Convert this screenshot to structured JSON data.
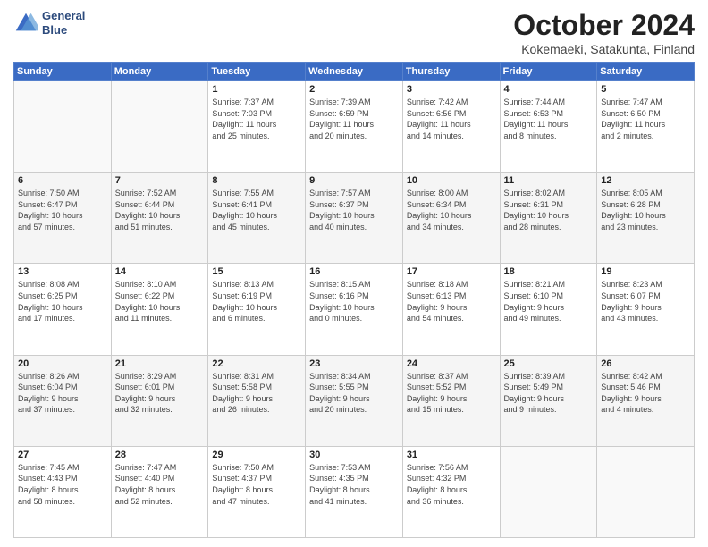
{
  "header": {
    "logo_line1": "General",
    "logo_line2": "Blue",
    "month": "October 2024",
    "location": "Kokemaeki, Satakunta, Finland"
  },
  "weekdays": [
    "Sunday",
    "Monday",
    "Tuesday",
    "Wednesday",
    "Thursday",
    "Friday",
    "Saturday"
  ],
  "weeks": [
    [
      {
        "day": "",
        "detail": ""
      },
      {
        "day": "",
        "detail": ""
      },
      {
        "day": "1",
        "detail": "Sunrise: 7:37 AM\nSunset: 7:03 PM\nDaylight: 11 hours\nand 25 minutes."
      },
      {
        "day": "2",
        "detail": "Sunrise: 7:39 AM\nSunset: 6:59 PM\nDaylight: 11 hours\nand 20 minutes."
      },
      {
        "day": "3",
        "detail": "Sunrise: 7:42 AM\nSunset: 6:56 PM\nDaylight: 11 hours\nand 14 minutes."
      },
      {
        "day": "4",
        "detail": "Sunrise: 7:44 AM\nSunset: 6:53 PM\nDaylight: 11 hours\nand 8 minutes."
      },
      {
        "day": "5",
        "detail": "Sunrise: 7:47 AM\nSunset: 6:50 PM\nDaylight: 11 hours\nand 2 minutes."
      }
    ],
    [
      {
        "day": "6",
        "detail": "Sunrise: 7:50 AM\nSunset: 6:47 PM\nDaylight: 10 hours\nand 57 minutes."
      },
      {
        "day": "7",
        "detail": "Sunrise: 7:52 AM\nSunset: 6:44 PM\nDaylight: 10 hours\nand 51 minutes."
      },
      {
        "day": "8",
        "detail": "Sunrise: 7:55 AM\nSunset: 6:41 PM\nDaylight: 10 hours\nand 45 minutes."
      },
      {
        "day": "9",
        "detail": "Sunrise: 7:57 AM\nSunset: 6:37 PM\nDaylight: 10 hours\nand 40 minutes."
      },
      {
        "day": "10",
        "detail": "Sunrise: 8:00 AM\nSunset: 6:34 PM\nDaylight: 10 hours\nand 34 minutes."
      },
      {
        "day": "11",
        "detail": "Sunrise: 8:02 AM\nSunset: 6:31 PM\nDaylight: 10 hours\nand 28 minutes."
      },
      {
        "day": "12",
        "detail": "Sunrise: 8:05 AM\nSunset: 6:28 PM\nDaylight: 10 hours\nand 23 minutes."
      }
    ],
    [
      {
        "day": "13",
        "detail": "Sunrise: 8:08 AM\nSunset: 6:25 PM\nDaylight: 10 hours\nand 17 minutes."
      },
      {
        "day": "14",
        "detail": "Sunrise: 8:10 AM\nSunset: 6:22 PM\nDaylight: 10 hours\nand 11 minutes."
      },
      {
        "day": "15",
        "detail": "Sunrise: 8:13 AM\nSunset: 6:19 PM\nDaylight: 10 hours\nand 6 minutes."
      },
      {
        "day": "16",
        "detail": "Sunrise: 8:15 AM\nSunset: 6:16 PM\nDaylight: 10 hours\nand 0 minutes."
      },
      {
        "day": "17",
        "detail": "Sunrise: 8:18 AM\nSunset: 6:13 PM\nDaylight: 9 hours\nand 54 minutes."
      },
      {
        "day": "18",
        "detail": "Sunrise: 8:21 AM\nSunset: 6:10 PM\nDaylight: 9 hours\nand 49 minutes."
      },
      {
        "day": "19",
        "detail": "Sunrise: 8:23 AM\nSunset: 6:07 PM\nDaylight: 9 hours\nand 43 minutes."
      }
    ],
    [
      {
        "day": "20",
        "detail": "Sunrise: 8:26 AM\nSunset: 6:04 PM\nDaylight: 9 hours\nand 37 minutes."
      },
      {
        "day": "21",
        "detail": "Sunrise: 8:29 AM\nSunset: 6:01 PM\nDaylight: 9 hours\nand 32 minutes."
      },
      {
        "day": "22",
        "detail": "Sunrise: 8:31 AM\nSunset: 5:58 PM\nDaylight: 9 hours\nand 26 minutes."
      },
      {
        "day": "23",
        "detail": "Sunrise: 8:34 AM\nSunset: 5:55 PM\nDaylight: 9 hours\nand 20 minutes."
      },
      {
        "day": "24",
        "detail": "Sunrise: 8:37 AM\nSunset: 5:52 PM\nDaylight: 9 hours\nand 15 minutes."
      },
      {
        "day": "25",
        "detail": "Sunrise: 8:39 AM\nSunset: 5:49 PM\nDaylight: 9 hours\nand 9 minutes."
      },
      {
        "day": "26",
        "detail": "Sunrise: 8:42 AM\nSunset: 5:46 PM\nDaylight: 9 hours\nand 4 minutes."
      }
    ],
    [
      {
        "day": "27",
        "detail": "Sunrise: 7:45 AM\nSunset: 4:43 PM\nDaylight: 8 hours\nand 58 minutes."
      },
      {
        "day": "28",
        "detail": "Sunrise: 7:47 AM\nSunset: 4:40 PM\nDaylight: 8 hours\nand 52 minutes."
      },
      {
        "day": "29",
        "detail": "Sunrise: 7:50 AM\nSunset: 4:37 PM\nDaylight: 8 hours\nand 47 minutes."
      },
      {
        "day": "30",
        "detail": "Sunrise: 7:53 AM\nSunset: 4:35 PM\nDaylight: 8 hours\nand 41 minutes."
      },
      {
        "day": "31",
        "detail": "Sunrise: 7:56 AM\nSunset: 4:32 PM\nDaylight: 8 hours\nand 36 minutes."
      },
      {
        "day": "",
        "detail": ""
      },
      {
        "day": "",
        "detail": ""
      }
    ]
  ]
}
